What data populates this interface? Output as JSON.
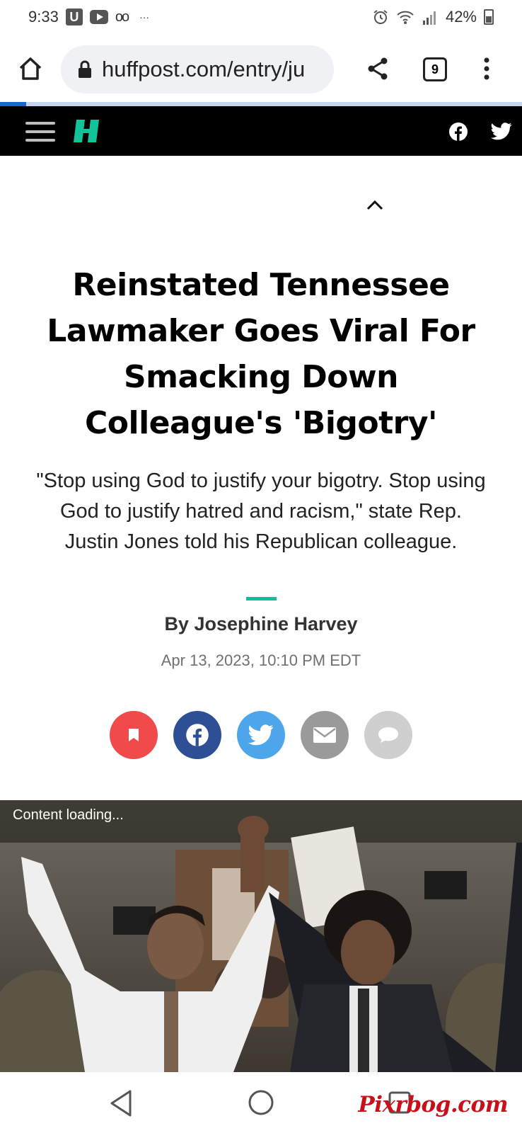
{
  "status_bar": {
    "time": "9:33",
    "u_label": "U",
    "voicemail": "oo",
    "more": "···",
    "battery": "42%"
  },
  "browser": {
    "url": "huffpost.com/entry/ju",
    "tab_count": "9"
  },
  "article": {
    "headline": "Reinstated Tennessee Lawmaker Goes Viral For Smacking Down Colleague's 'Bigotry'",
    "dek": "\"Stop using God to justify your bigotry. Stop using God to justify hatred and racism,\" state Rep. Justin Jones told his Republican colleague.",
    "byline": "By Josephine Harvey",
    "date": "Apr 13, 2023, 10:10 PM EDT"
  },
  "colors": {
    "accent": "#0dbe98",
    "bookmark": "#f04a4a",
    "facebook": "#2f4f95",
    "twitter": "#4da6ea",
    "email": "#9a9a9a",
    "comment": "#cfcfcf",
    "brand_green": "#12c39a"
  },
  "photo": {
    "loading_text": "Content loading..."
  },
  "watermark": "Pixrbog.com"
}
